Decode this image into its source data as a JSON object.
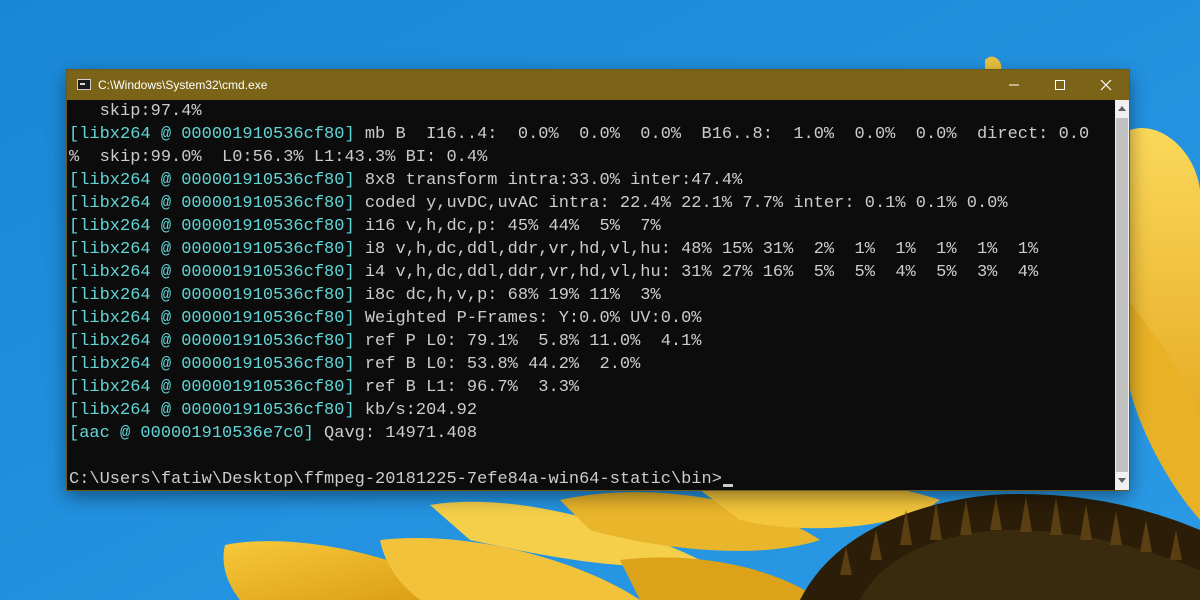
{
  "window": {
    "title": "C:\\Windows\\System32\\cmd.exe",
    "title_bar_color": "#7b6418",
    "icon": "cmd-icon"
  },
  "controls": {
    "minimize": "minimize-icon",
    "maximize": "maximize-icon",
    "close": "close-icon"
  },
  "console": {
    "lines": [
      {
        "prefix": "",
        "text": "   skip:97.4%"
      },
      {
        "prefix": "[libx264 @ 000001910536cf80]",
        "text": " mb B  I16..4:  0.0%  0.0%  0.0%  B16..8:  1.0%  0.0%  0.0%  direct: 0.0"
      },
      {
        "prefix": "",
        "text": "%  skip:99.0%  L0:56.3% L1:43.3% BI: 0.4%"
      },
      {
        "prefix": "[libx264 @ 000001910536cf80]",
        "text": " 8x8 transform intra:33.0% inter:47.4%"
      },
      {
        "prefix": "[libx264 @ 000001910536cf80]",
        "text": " coded y,uvDC,uvAC intra: 22.4% 22.1% 7.7% inter: 0.1% 0.1% 0.0%"
      },
      {
        "prefix": "[libx264 @ 000001910536cf80]",
        "text": " i16 v,h,dc,p: 45% 44%  5%  7%"
      },
      {
        "prefix": "[libx264 @ 000001910536cf80]",
        "text": " i8 v,h,dc,ddl,ddr,vr,hd,vl,hu: 48% 15% 31%  2%  1%  1%  1%  1%  1%"
      },
      {
        "prefix": "[libx264 @ 000001910536cf80]",
        "text": " i4 v,h,dc,ddl,ddr,vr,hd,vl,hu: 31% 27% 16%  5%  5%  4%  5%  3%  4%"
      },
      {
        "prefix": "[libx264 @ 000001910536cf80]",
        "text": " i8c dc,h,v,p: 68% 19% 11%  3%"
      },
      {
        "prefix": "[libx264 @ 000001910536cf80]",
        "text": " Weighted P-Frames: Y:0.0% UV:0.0%"
      },
      {
        "prefix": "[libx264 @ 000001910536cf80]",
        "text": " ref P L0: 79.1%  5.8% 11.0%  4.1%"
      },
      {
        "prefix": "[libx264 @ 000001910536cf80]",
        "text": " ref B L0: 53.8% 44.2%  2.0%"
      },
      {
        "prefix": "[libx264 @ 000001910536cf80]",
        "text": " ref B L1: 96.7%  3.3%"
      },
      {
        "prefix": "[libx264 @ 000001910536cf80]",
        "text": " kb/s:204.92"
      },
      {
        "prefix": "[aac @ 000001910536e7c0]",
        "text": " Qavg: 14971.408"
      },
      {
        "prefix": "",
        "text": ""
      },
      {
        "prefix": "",
        "text": "C:\\Users\\fatiw\\Desktop\\ffmpeg-20181225-7efe84a-win64-static\\bin>"
      }
    ],
    "text_color": "#cccccc",
    "tag_color": "#61d6d6",
    "background_color": "#0c0c0c"
  },
  "desktop": {
    "background_color": "#1a8fdc",
    "wallpaper": "sunflower-wallpaper"
  }
}
